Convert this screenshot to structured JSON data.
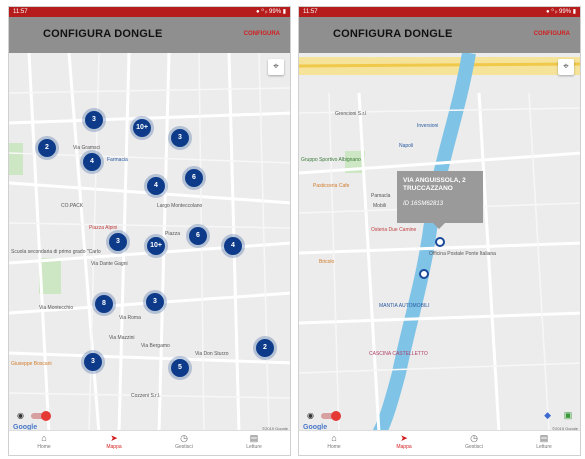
{
  "status": {
    "time": "11:57",
    "right": "● ⁰ ᵢₗ 99% ▮"
  },
  "app": {
    "title": "CONFIGURA DONGLE",
    "action": "CONFIGURA"
  },
  "left_map": {
    "clusters": [
      "3",
      "10+",
      "2",
      "4",
      "3",
      "6",
      "4",
      "3",
      "10+",
      "6",
      "4",
      "8",
      "3",
      "2",
      "3",
      "5"
    ],
    "labels": {
      "l1": "Via Gramsci",
      "l2": "Farmacia",
      "l3": "CO.PACK",
      "l4": "Largo Monteccolano",
      "l5": "Piazza Alpini",
      "l6": "Scuola secondaria di primo grado \"Carlo",
      "l7": "Via Dante Gagni",
      "l8": "Via Montecchio",
      "l9": "Via Roma",
      "l10": "Piazza",
      "l11": "Via Bergamo",
      "l12": "Via Mazzini",
      "l13": "Via Don Sturzo",
      "l14": "Giuseppe Boscani",
      "l15": "Cozzeni S.r.l."
    }
  },
  "right_map": {
    "callout": {
      "address": "VIA ANGUISSOLA, 2 TRUCCAZZANO",
      "id": "ID 16SM62813"
    },
    "labels": {
      "r1": "Grencioni S.r.l",
      "r2": "Inversioni",
      "r3": "Napoli",
      "r4": "Gruppo Sportivo Albignano",
      "r5": "Pasticceria Cafe",
      "r6": "Pamacla",
      "r7": "Mobili",
      "r8": "Osteria Due Camine",
      "r9": "Officina Postale Ponte Italiana",
      "r10": "Bricolo",
      "r11": "MANTIA AUTOMOBILI",
      "r12": "CASCINA CASTELLETTO"
    }
  },
  "google": {
    "logo": "Google",
    "copyright": "©2019 Google"
  },
  "nav": [
    {
      "icon": "home-icon",
      "label": "Home"
    },
    {
      "icon": "send-icon",
      "label": "Mappa"
    },
    {
      "icon": "history-icon",
      "label": "Gestisci"
    },
    {
      "icon": "document-icon",
      "label": "Letture"
    }
  ],
  "colors": {
    "accent": "#d21f1f",
    "cluster": "#0d3b8a",
    "river": "#7fc3e6",
    "appbar": "#8f8f8f"
  }
}
